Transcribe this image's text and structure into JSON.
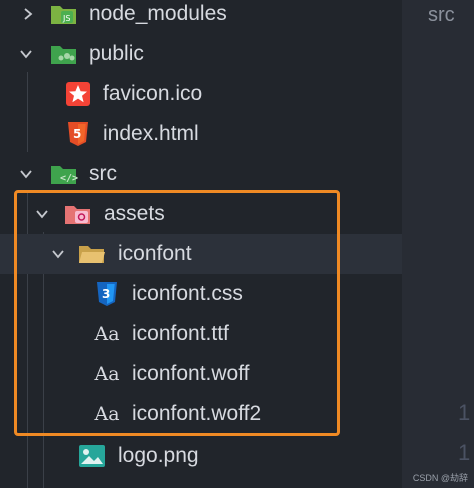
{
  "editor": {
    "tab_label": "src",
    "line_numbers": [
      "1",
      "1"
    ]
  },
  "tree": {
    "node_modules": {
      "label": "node_modules",
      "icon": "node-modules-folder-icon"
    },
    "public": {
      "label": "public",
      "icon": "public-folder-icon"
    },
    "favicon": {
      "label": "favicon.ico",
      "icon": "star-icon"
    },
    "index_html": {
      "label": "index.html",
      "icon": "html5-icon"
    },
    "src": {
      "label": "src",
      "icon": "src-folder-icon"
    },
    "assets": {
      "label": "assets",
      "icon": "assets-folder-icon"
    },
    "iconfont": {
      "label": "iconfont",
      "icon": "folder-open-icon"
    },
    "iconfont_css": {
      "label": "iconfont.css",
      "icon": "css3-icon"
    },
    "iconfont_ttf": {
      "label": "iconfont.ttf",
      "icon": "font-icon",
      "glyph": "Aa"
    },
    "iconfont_woff": {
      "label": "iconfont.woff",
      "icon": "font-icon",
      "glyph": "Aa"
    },
    "iconfont_woff2": {
      "label": "iconfont.woff2",
      "icon": "font-icon",
      "glyph": "Aa"
    },
    "logo": {
      "label": "logo.png",
      "icon": "image-icon"
    }
  },
  "colors": {
    "highlight_border": "#f08a24",
    "folder_green": "#3fa34d",
    "html_orange": "#e44d26",
    "css_blue": "#2196f3",
    "image_teal": "#26a69a"
  },
  "watermark": "CSDN @劫辞"
}
